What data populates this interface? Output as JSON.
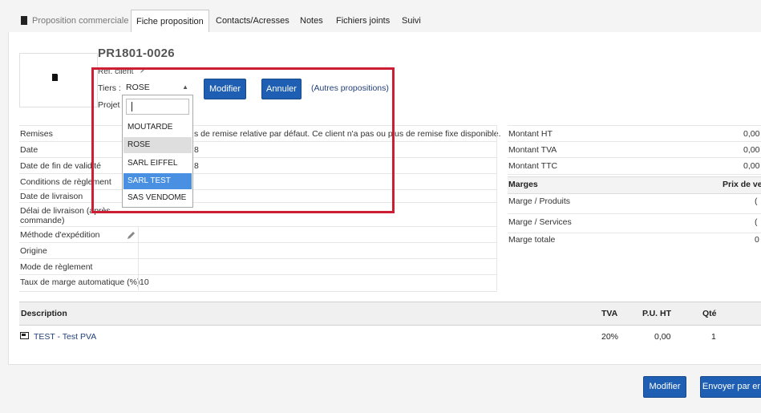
{
  "tabs": {
    "proposal": "Proposition commerciale",
    "sheet": "Fiche proposition",
    "contacts": "Contacts/Acresses",
    "notes": "Notes",
    "files": "Fichiers joints",
    "follow": "Suivi"
  },
  "header": {
    "ref": "PR1801-0026",
    "ref_client": "Réf. client"
  },
  "tiers": {
    "label": "Tiers :",
    "selected": "ROSE",
    "modify_button": "Modifier",
    "cancel_button": "Annuler",
    "other_link": "(Autres propositions)"
  },
  "projet": {
    "label": "Projet"
  },
  "dropdown": {
    "search_value": "",
    "options": [
      "MOUTARDE",
      "ROSE",
      "SARL EIFFEL",
      "SARL TEST",
      "SAS VENDOME"
    ],
    "highlighted": "SARL TEST",
    "hovered": "ROSE"
  },
  "fields": {
    "remises_label": "Remises",
    "remises_value": "s de remise relative par défaut. Ce client n'a pas ou plus de remise fixe disponible.",
    "date_label": "Date",
    "date_value": "8",
    "fin_validite_label": "Date de fin de validité",
    "fin_validite_value": "8",
    "conditions_label": "Conditions de règlement",
    "livraison_label": "Date de livraison",
    "delai_label": "Délai de livraison (après commande)",
    "expedition_label": "Méthode d'expédition",
    "origine_label": "Origine",
    "mode_label": "Mode de règlement",
    "taux_label": "Taux de marge automatique (%)",
    "taux_value": "10"
  },
  "totals": {
    "ht_label": "Montant HT",
    "ht_value": "0,00",
    "tva_label": "Montant TVA",
    "tva_value": "0,00",
    "ttc_label": "Montant TTC",
    "ttc_value": "0,00"
  },
  "marges": {
    "header": "Marges",
    "header_right": "Prix de ve",
    "produits": "Marge / Produits",
    "services": "Marge / Services",
    "totale": "Marge totale",
    "produits_value": "(",
    "services_value": "(",
    "totale_value": "0"
  },
  "lines": {
    "headers": {
      "description": "Description",
      "tva": "TVA",
      "pu_ht": "P.U. HT",
      "qty": "Qté"
    },
    "items": [
      {
        "description": "TEST - Test PVA",
        "tva": "20%",
        "pu_ht": "0,00",
        "qty": "1"
      }
    ]
  },
  "footer": {
    "modify_button": "Modifier",
    "send_button": "Envoyer par er"
  },
  "colors": {
    "primary": "#1f5fb3",
    "highlight": "#4a90e2",
    "red_frame": "#cc1f33"
  }
}
